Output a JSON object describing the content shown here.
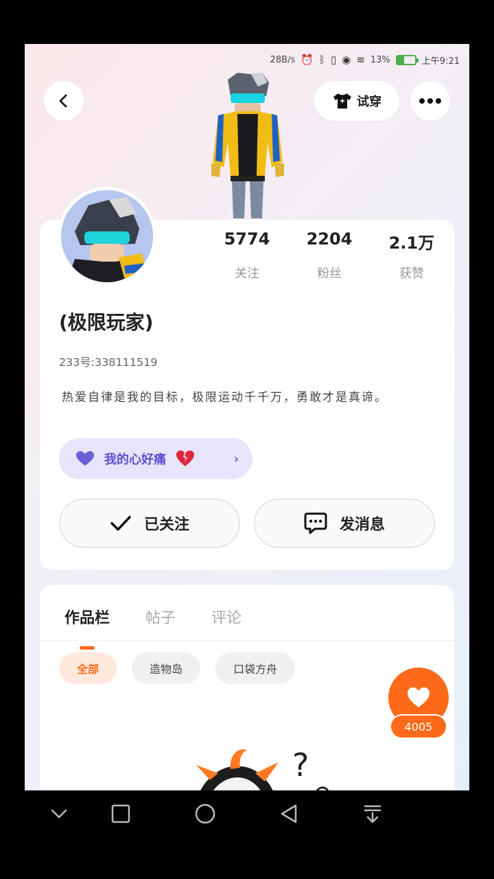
{
  "status_bar": {
    "net_speed": "28B/s",
    "battery": "13%",
    "time": "上午9:21"
  },
  "header": {
    "outfit_label": "试穿"
  },
  "profile": {
    "stats": [
      {
        "value": "5774",
        "label": "关注"
      },
      {
        "value": "2204",
        "label": "粉丝"
      },
      {
        "value": "2.1万",
        "label": "获赞"
      }
    ],
    "username": "(极限玩家)",
    "uid": "233号:338111519",
    "bio": "热爱自律是我的目标，极限运动千千万，勇敢才是真谛。",
    "mood": "我的心好痛",
    "follow_label": "已关注",
    "message_label": "发消息"
  },
  "works": {
    "tabs": [
      "作品栏",
      "帖子",
      "评论"
    ],
    "chips": [
      "全部",
      "造物岛",
      "口袋方舟"
    ]
  },
  "like_count": "4005",
  "colors": {
    "accent": "#ff6a1a",
    "mood_bg": "#e8e4fb",
    "mood_text": "#5b4fd1"
  }
}
